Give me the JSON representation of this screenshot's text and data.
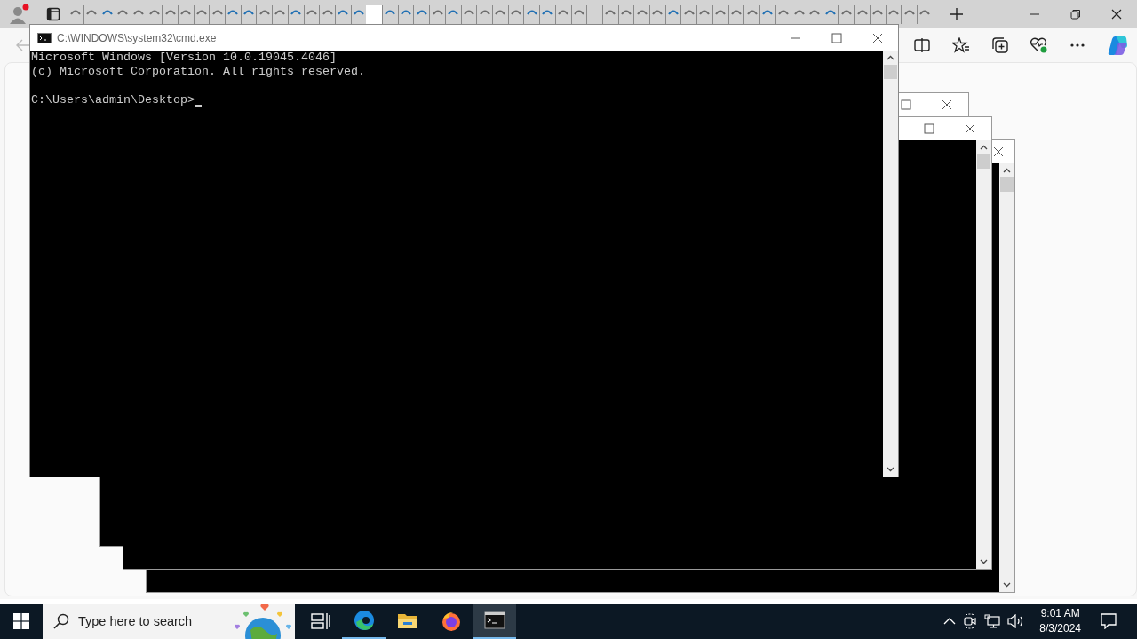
{
  "browser": {
    "tabs": [
      {
        "color": "#6b6b6b",
        "selected": false
      },
      {
        "color": "#6b6b6b",
        "selected": false
      },
      {
        "color": "#1f6fb3",
        "selected": false
      },
      {
        "color": "#6b6b6b",
        "selected": false
      },
      {
        "color": "#6b6b6b",
        "selected": false
      },
      {
        "color": "#6b6b6b",
        "selected": false
      },
      {
        "color": "#6b6b6b",
        "selected": false
      },
      {
        "color": "#6b6b6b",
        "selected": false
      },
      {
        "color": "#6b6b6b",
        "selected": false
      },
      {
        "color": "#6b6b6b",
        "selected": false
      },
      {
        "color": "#1f6fb3",
        "selected": false
      },
      {
        "color": "#1f6fb3",
        "selected": false
      },
      {
        "color": "#6b6b6b",
        "selected": false
      },
      {
        "color": "#6b6b6b",
        "selected": false
      },
      {
        "color": "#1f6fb3",
        "selected": false
      },
      {
        "color": "#6b6b6b",
        "selected": false
      },
      {
        "color": "#6b6b6b",
        "selected": false
      },
      {
        "color": "#1f6fb3",
        "selected": false
      },
      {
        "color": "#1f6fb3",
        "selected": false
      },
      {
        "selected": true
      },
      {
        "color": "#1f6fb3",
        "selected": false
      },
      {
        "color": "#1f6fb3",
        "selected": false
      },
      {
        "color": "#1f6fb3",
        "selected": false
      },
      {
        "color": "#6b6b6b",
        "selected": false
      },
      {
        "color": "#1f6fb3",
        "selected": false
      },
      {
        "color": "#6b6b6b",
        "selected": false
      },
      {
        "color": "#6b6b6b",
        "selected": false
      },
      {
        "color": "#6b6b6b",
        "selected": false
      },
      {
        "color": "#6b6b6b",
        "selected": false
      },
      {
        "color": "#1f6fb3",
        "selected": false
      },
      {
        "color": "#1f6fb3",
        "selected": false
      },
      {
        "color": "#6b6b6b",
        "selected": false
      },
      {
        "color": "#6b6b6b",
        "selected": false
      },
      {
        "selected": false
      },
      {
        "color": "#6b6b6b",
        "selected": false
      },
      {
        "color": "#6b6b6b",
        "selected": false
      },
      {
        "color": "#6b6b6b",
        "selected": false
      },
      {
        "color": "#6b6b6b",
        "selected": false
      },
      {
        "color": "#1f6fb3",
        "selected": false
      },
      {
        "color": "#6b6b6b",
        "selected": false
      },
      {
        "color": "#6b6b6b",
        "selected": false
      },
      {
        "color": "#6b6b6b",
        "selected": false
      },
      {
        "color": "#6b6b6b",
        "selected": false
      },
      {
        "color": "#6b6b6b",
        "selected": false
      },
      {
        "color": "#1f6fb3",
        "selected": false
      },
      {
        "color": "#6b6b6b",
        "selected": false
      },
      {
        "color": "#6b6b6b",
        "selected": false
      },
      {
        "color": "#6b6b6b",
        "selected": false
      },
      {
        "color": "#1f6fb3",
        "selected": false
      },
      {
        "color": "#6b6b6b",
        "selected": false
      },
      {
        "color": "#6b6b6b",
        "selected": false
      },
      {
        "color": "#6b6b6b",
        "selected": false
      },
      {
        "color": "#6b6b6b",
        "selected": false
      },
      {
        "color": "#6b6b6b",
        "selected": false
      },
      {
        "color": "#6b6b6b",
        "selected": false
      }
    ]
  },
  "console": {
    "title": "C:\\WINDOWS\\system32\\cmd.exe",
    "lines": [
      "Microsoft Windows [Version 10.0.19045.4046]",
      "(c) Microsoft Corporation. All rights reserved."
    ],
    "prompt": "C:\\Users\\admin\\Desktop>"
  },
  "taskbar": {
    "search": {
      "placeholder": "Type here to search"
    },
    "apps": [
      {
        "kind": "taskview",
        "running": false,
        "selected": false
      },
      {
        "kind": "edge",
        "running": true,
        "selected": false
      },
      {
        "kind": "explorer",
        "running": false,
        "selected": false
      },
      {
        "kind": "firefox",
        "running": false,
        "selected": false
      },
      {
        "kind": "terminal",
        "running": true,
        "selected": true
      }
    ],
    "clock": {
      "time": "9:01 AM",
      "date": "8/3/2024"
    }
  }
}
